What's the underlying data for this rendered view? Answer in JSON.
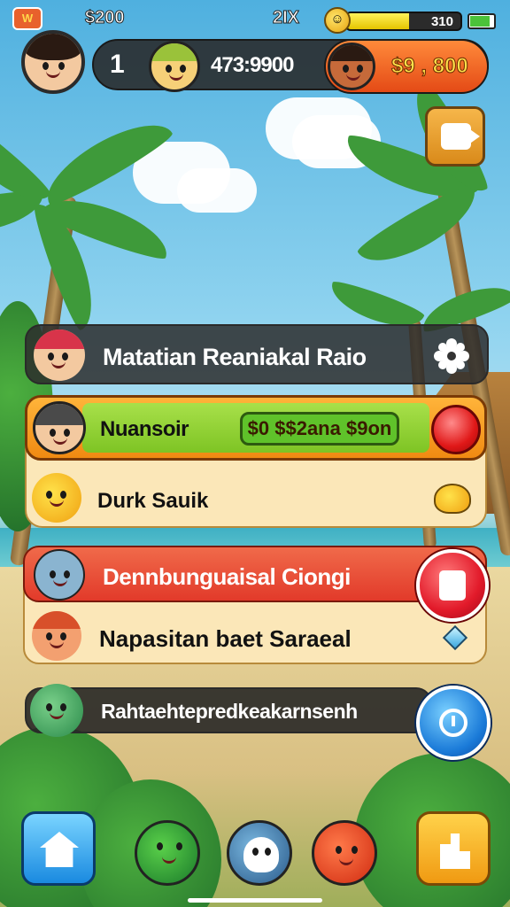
{
  "status_bar": {
    "badge": "W",
    "time": "$200",
    "multiplier": "2IX",
    "energy_value": "310",
    "energy_fraction": 0.55,
    "battery_level": 0.85
  },
  "header": {
    "rank": "1",
    "score": "473:9900",
    "coins": "$9 , 800"
  },
  "menu": {
    "item1_label": "Matatian Reaniakal Raio",
    "item2_label": "Nuansoir",
    "item2_offer": "$0 $$2ana $9on",
    "item3_label": "Durk Sauik",
    "item4_label": "Dennbunguaisal Ciongi",
    "item5_label": "Napasitan baet Saraeal",
    "item6_label": "Rahtaehtepredkeakarnsenh"
  },
  "colors": {
    "accent_orange": "#f08a12",
    "accent_red": "#e21a2a",
    "accent_blue": "#1a7ad8",
    "accent_green": "#7ec424"
  },
  "icons": {
    "settings": "gear-icon",
    "share": "share-icon",
    "calendar": "calendar-icon",
    "clock": "clock-icon",
    "home": "home-icon",
    "stats": "stats-icon"
  }
}
